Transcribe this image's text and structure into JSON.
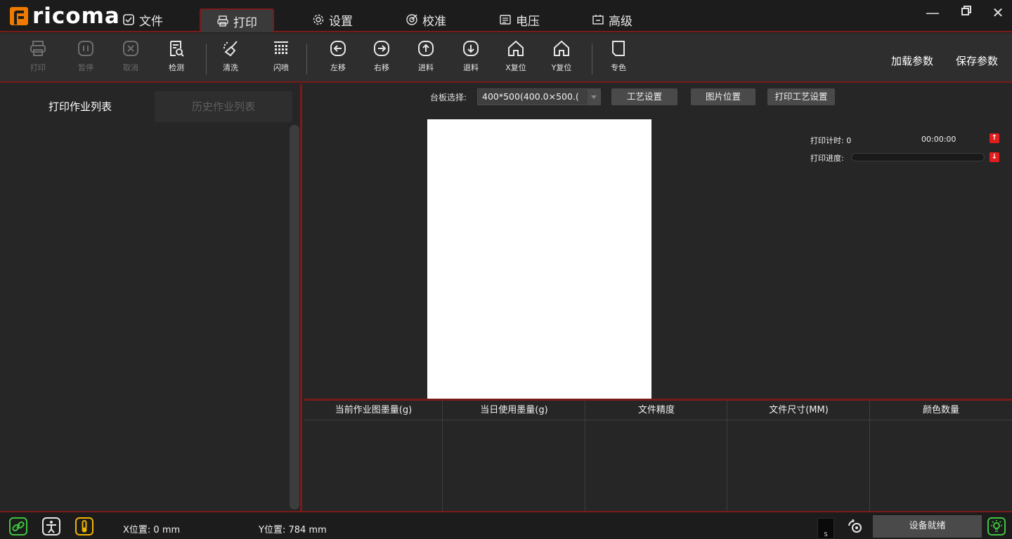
{
  "app": {
    "logo_text": "ricoma"
  },
  "menu": {
    "tabs": [
      {
        "label": "文件",
        "icon": "file-check-icon"
      },
      {
        "label": "打印",
        "icon": "printer-icon",
        "active": true
      },
      {
        "label": "设置",
        "icon": "gear-icon"
      },
      {
        "label": "校准",
        "icon": "target-icon"
      },
      {
        "label": "电压",
        "icon": "voltage-icon"
      },
      {
        "label": "高级",
        "icon": "advanced-icon"
      }
    ]
  },
  "toolbar": {
    "print": "打印",
    "pause": "暂停",
    "cancel": "取消",
    "detect": "检测",
    "clean": "清洗",
    "flash": "闪喷",
    "move_left": "左移",
    "move_right": "右移",
    "feed": "进料",
    "retract": "退料",
    "x_reset": "X复位",
    "y_reset": "Y复位",
    "spot_color": "专色",
    "load_params": "加载参数",
    "save_params": "保存参数"
  },
  "left_panel": {
    "tab_jobs": "打印作业列表",
    "tab_history": "历史作业列表"
  },
  "main": {
    "board_label": "台板选择:",
    "board_value": "400*500(400.0×500.(",
    "process_settings": "工艺设置",
    "image_position": "图片位置",
    "print_process_settings": "打印工艺设置",
    "print_timer_label": "打印计时: 0",
    "print_timer_value": "00:00:00",
    "print_progress_label": "打印进度:",
    "print_progress": 0
  },
  "ink_table": {
    "headers": [
      "当前作业图墨量(g)",
      "当日使用墨量(g)",
      "文件精度",
      "文件尺寸(MM)",
      "颜色数量"
    ]
  },
  "status": {
    "x_position": "X位置: 0 mm",
    "y_position": "Y位置: 784 mm",
    "ink_label": "S",
    "device_status": "设备就绪"
  },
  "colors": {
    "accent_red": "#7a1b1b",
    "logo_orange": "#f07a00",
    "status_green": "#3ec43e",
    "status_yellow": "#f0b400",
    "alert_red": "#e01e1e"
  }
}
